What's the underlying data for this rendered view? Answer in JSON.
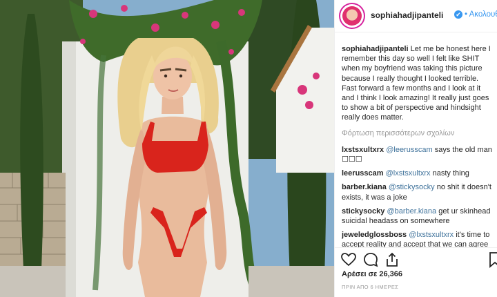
{
  "post": {
    "username": "sophiahadjipanteli",
    "verified_mark": "✔",
    "follow_label": "• Ακολουθήστε"
  },
  "caption": {
    "author": "sophiahadjipanteli",
    "text": "Let me be honest here I remember this day so well I felt like SHIT when my boyfriend was taking this picture because I really thought I looked terrible. Fast forward a few months and I look at it and I think I look amazing! It really just goes to show a bit of perspective and hindsight really does matter."
  },
  "load_more": "Φόρτωση περισσότερων σχολίων",
  "comments": [
    {
      "user": "lxstsxultxrx",
      "mention": "@leerusscam",
      "text": "says the old man ☐☐☐"
    },
    {
      "user": "leerusscam",
      "mention": "@lxstsxultxrx",
      "text": "nasty thing"
    },
    {
      "user": "barber.kiana",
      "mention": "@stickysocky",
      "text": "no shit it doesn't exists, it was a joke"
    },
    {
      "user": "stickysocky",
      "mention": "@barber.kiana",
      "text": "get ur skinhead suicidal headass on somewhere"
    },
    {
      "user": "jeweledglossboss",
      "mention": "@lxstsxultxrx",
      "text": "it's time to accept reality and accept that we can agree to disagree"
    }
  ],
  "actions": {
    "like_icon": "heart-icon",
    "comment_icon": "comment-bubble-icon",
    "share_icon": "share-icon",
    "save_icon": "bookmark-icon"
  },
  "likes": "Αρέσει σε 26,366",
  "timestamp": "ΠΡΙΝ ΑΠΟ 6 ΗΜΕΡΕΣ",
  "colors": {
    "link": "#3897f0",
    "mention": "#3f729b",
    "muted": "#999999",
    "swimsuit": "#d9241c",
    "sky": "#7fa8c9"
  }
}
